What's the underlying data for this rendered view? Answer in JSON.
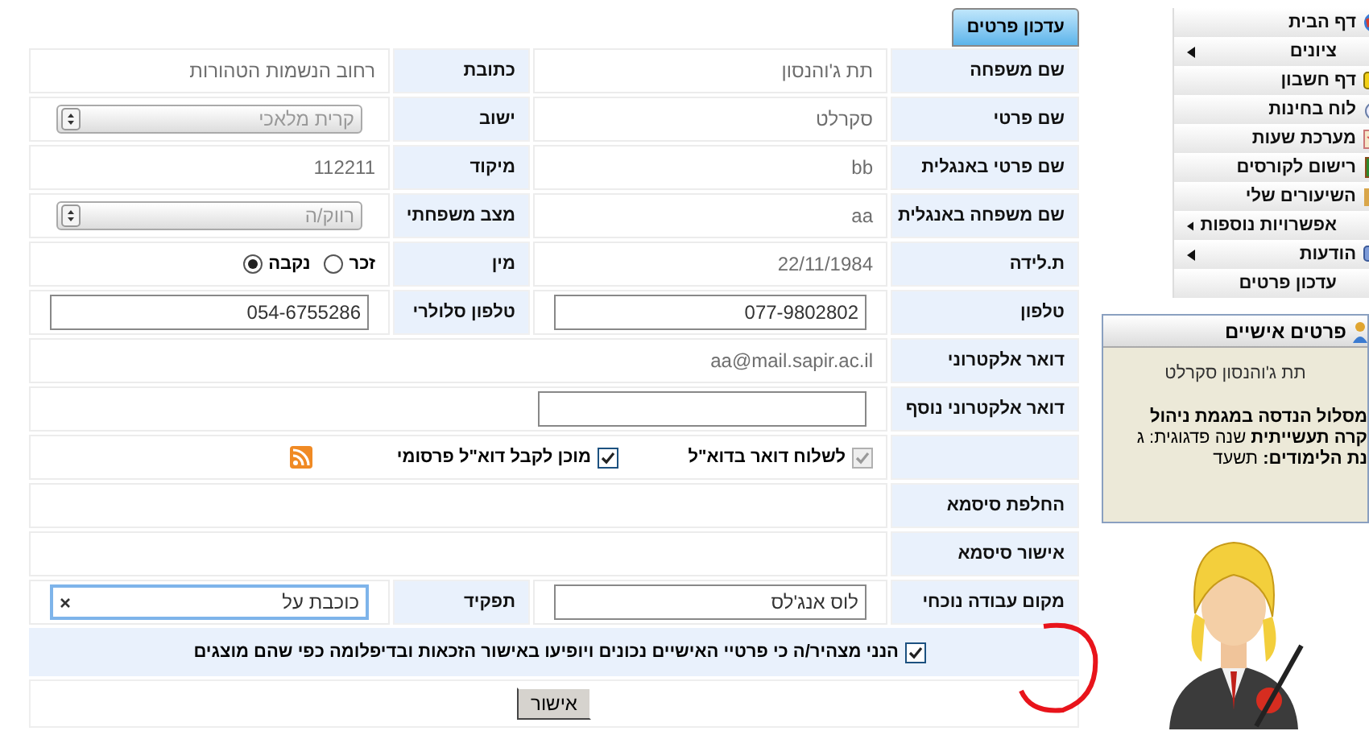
{
  "tab": {
    "label": "עדכון פרטים",
    "selected": true
  },
  "form": {
    "rows": [
      {
        "kind": "double",
        "fields": [
          {
            "label": "שם משפחה",
            "kind": "text",
            "value": "תת ג'והנסון"
          },
          {
            "label": "כתובת",
            "kind": "text",
            "value": "רחוב הנשמות הטהורות"
          }
        ]
      },
      {
        "kind": "double",
        "fields": [
          {
            "label": "שם פרטי",
            "kind": "text",
            "value": "סקרלט"
          },
          {
            "label": "ישוב",
            "kind": "select",
            "value": "קרית מלאכי"
          }
        ]
      },
      {
        "kind": "double",
        "fields": [
          {
            "label": "שם פרטי באנגלית",
            "kind": "text",
            "value": "bb"
          },
          {
            "label": "מיקוד",
            "kind": "text",
            "value": "112211"
          }
        ]
      },
      {
        "kind": "double",
        "fields": [
          {
            "label": "שם משפחה באנגלית",
            "kind": "text",
            "value": "aa"
          },
          {
            "label": "מצב משפחתי",
            "kind": "select",
            "value": "רווק/ה"
          }
        ]
      },
      {
        "kind": "double",
        "fields": [
          {
            "label": "ת.לידה",
            "kind": "text",
            "value": "22/11/1984"
          },
          {
            "label": "מין",
            "kind": "radio",
            "options": [
              {
                "label": "זכר",
                "selected": false
              },
              {
                "label": "נקבה",
                "selected": true
              }
            ]
          }
        ]
      },
      {
        "kind": "double",
        "fields": [
          {
            "label": "טלפון",
            "kind": "input",
            "value": "077-9802802",
            "focused": false
          },
          {
            "label": "טלפון סלולרי",
            "kind": "input",
            "value": "054-6755286",
            "focused": false
          }
        ]
      },
      {
        "kind": "wide",
        "label": "דואר אלקטרוני",
        "field": {
          "kind": "text",
          "value": "aa@mail.sapir.ac.il"
        }
      },
      {
        "kind": "wide",
        "label": "דואר אלקטרוני נוסף",
        "field": {
          "kind": "input",
          "focused": false
        }
      },
      {
        "kind": "checks",
        "items": [
          {
            "label": "לשלוח דואר בדוא\"ל",
            "checked": true,
            "disabled": true
          },
          {
            "label": "מוכן לקבל דוא\"ל פרסומי",
            "checked": true,
            "disabled": false
          }
        ]
      },
      {
        "kind": "wide",
        "label": "החלפת סיסמא",
        "field": {
          "kind": "text"
        }
      },
      {
        "kind": "wide",
        "label": "אישור סיסמא",
        "field": {
          "kind": "text"
        }
      },
      {
        "kind": "double",
        "fields": [
          {
            "label": "מקום עבודה נוכחי",
            "kind": "input",
            "value": "לוס אנג'לס",
            "focused": false
          },
          {
            "label": "תפקיד",
            "kind": "input",
            "value": "כוכבת על",
            "focused": true
          }
        ]
      },
      {
        "kind": "declaration",
        "text": "הנני מצהיר/ה כי פרטיי האישיים נכונים ויופיעו באישור הזכאות ובדיפלומה כפי שהם מוצגים",
        "checked": true
      }
    ],
    "submit": "אישור"
  },
  "menu": {
    "items": [
      {
        "label": "דף הבית",
        "submenu": false
      },
      {
        "label": "ציונים",
        "submenu": true
      },
      {
        "label": "דף חשבון",
        "submenu": false
      },
      {
        "label": "לוח בחינות",
        "submenu": false
      },
      {
        "label": "מערכת שעות",
        "submenu": false
      },
      {
        "label": "רישום לקורסים",
        "submenu": false
      },
      {
        "label": "השיעורים שלי",
        "submenu": false
      },
      {
        "label": "אפשרויות נוספות",
        "submenu": true
      },
      {
        "label": "הודעות",
        "submenu": true
      },
      {
        "label": "עדכון פרטים",
        "submenu": false
      }
    ]
  },
  "personal": {
    "title": "פרטים אישיים",
    "name": "תת ג'והנסון סקרלט",
    "lines": [
      "**מסלול הנדסה במגמת ניהול**",
      "**קרה תעשייתית** שנה פדגוגית: ג",
      "**נת הלימודים:** תשעד"
    ]
  }
}
